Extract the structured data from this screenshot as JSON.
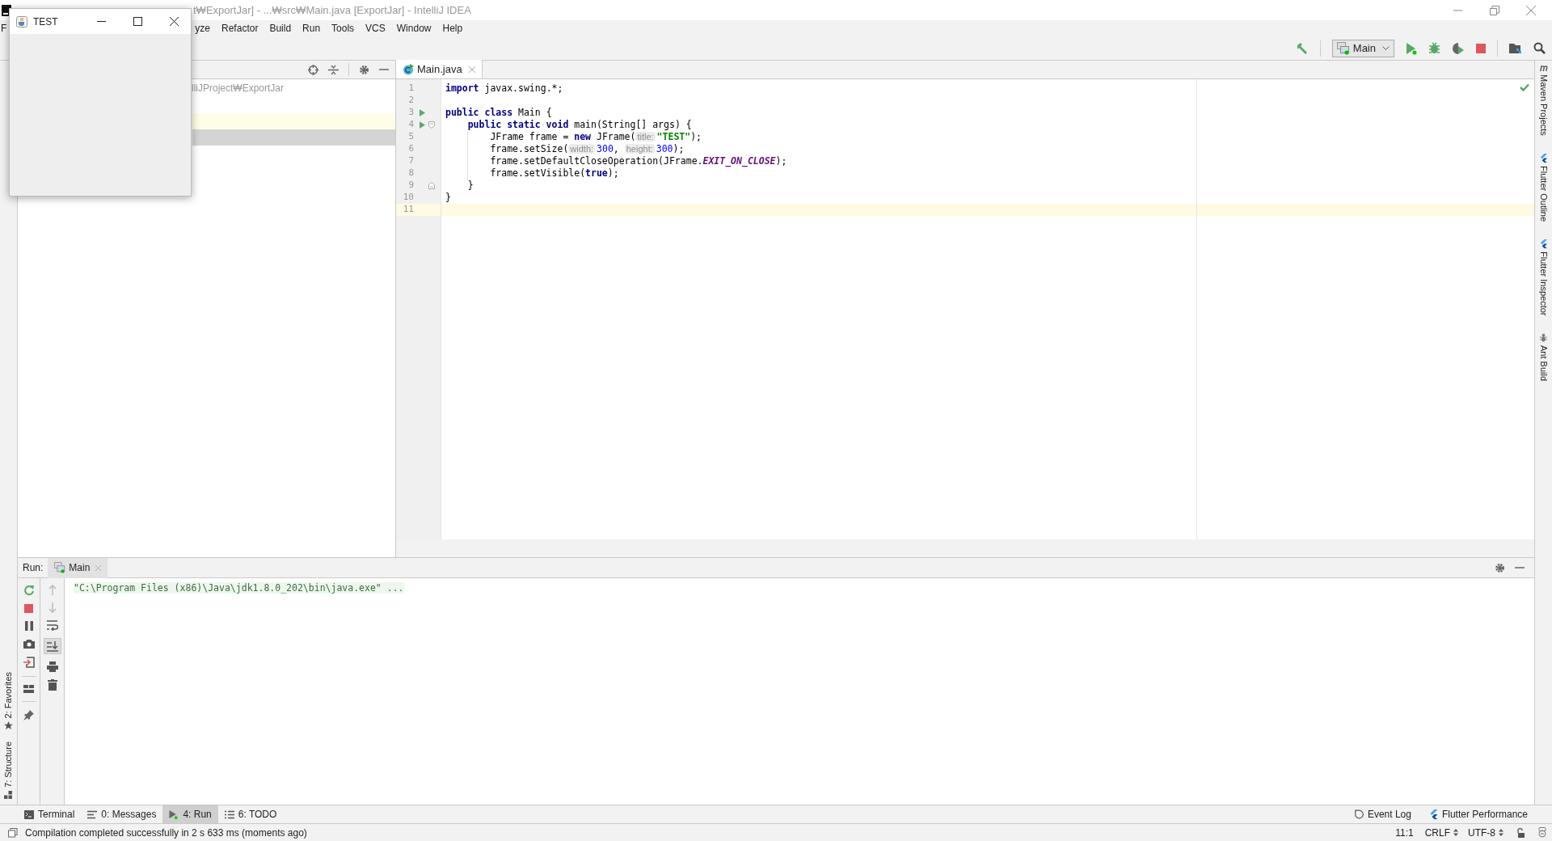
{
  "title_bar": {
    "text": "t₩ExportJar] - ...₩src₩Main.java [ExportJar] - IntelliJ IDEA"
  },
  "menu": [
    "F",
    "yze",
    "Refactor",
    "Build",
    "Run",
    "Tools",
    "VCS",
    "Window",
    "Help"
  ],
  "run_config": {
    "label": "Main"
  },
  "project_panel": {
    "path": "lliJProject₩ExportJar"
  },
  "editor_tab": {
    "label": "Main.java",
    "selected": true
  },
  "code_lines": [
    {
      "number": "1",
      "run_marker": false,
      "fold_start": false,
      "fold_end": false,
      "current": false,
      "tokens": [
        {
          "kind": "keyword",
          "text": "import"
        },
        {
          "kind": "plain",
          "text": " javax.swing.*;"
        }
      ]
    },
    {
      "number": "2",
      "run_marker": false,
      "fold_start": false,
      "fold_end": false,
      "current": false
    },
    {
      "number": "3",
      "run_marker": true,
      "fold_start": false,
      "fold_end": false,
      "current": false,
      "tokens": [
        {
          "kind": "keyword",
          "text": "public class"
        },
        {
          "kind": "plain",
          "text": " Main {"
        }
      ]
    },
    {
      "number": "4",
      "run_marker": true,
      "fold_start": true,
      "fold_end": false,
      "current": false,
      "tokens": [
        {
          "kind": "keyword",
          "text": "    public static void"
        },
        {
          "kind": "plain",
          "text": " main(String[] args) {"
        }
      ]
    },
    {
      "number": "5",
      "run_marker": false,
      "fold_start": false,
      "fold_end": false,
      "current": false,
      "tokens": [
        {
          "kind": "plain",
          "text": "        JFrame frame = "
        },
        {
          "kind": "keyword",
          "text": "new"
        },
        {
          "kind": "plain",
          "text": " JFrame("
        },
        {
          "kind": "hint",
          "text": "title:"
        },
        {
          "kind": "string",
          "text": "\"TEST\""
        },
        {
          "kind": "plain",
          "text": ");"
        }
      ]
    },
    {
      "number": "6",
      "run_marker": false,
      "fold_start": false,
      "fold_end": false,
      "current": false,
      "tokens": [
        {
          "kind": "plain",
          "text": "        frame.setSize("
        },
        {
          "kind": "hint",
          "text": "width:"
        },
        {
          "kind": "number",
          "text": "300"
        },
        {
          "kind": "plain",
          "text": ", "
        },
        {
          "kind": "hint",
          "text": "height:"
        },
        {
          "kind": "number",
          "text": "300"
        },
        {
          "kind": "plain",
          "text": ");"
        }
      ]
    },
    {
      "number": "7",
      "run_marker": false,
      "fold_start": false,
      "fold_end": false,
      "current": false,
      "tokens": [
        {
          "kind": "plain",
          "text": "        frame.setDefaultCloseOperation(JFrame."
        },
        {
          "kind": "constant",
          "text": "EXIT_ON_CLOSE"
        },
        {
          "kind": "plain",
          "text": ");"
        }
      ]
    },
    {
      "number": "8",
      "run_marker": false,
      "fold_start": false,
      "fold_end": false,
      "current": false,
      "tokens": [
        {
          "kind": "plain",
          "text": "        frame.setVisible("
        },
        {
          "kind": "keyword",
          "text": "true"
        },
        {
          "kind": "plain",
          "text": ");"
        }
      ]
    },
    {
      "number": "9",
      "run_marker": false,
      "fold_start": false,
      "fold_end": true,
      "current": false,
      "tokens": [
        {
          "kind": "plain",
          "text": "    }"
        }
      ]
    },
    {
      "number": "10",
      "run_marker": false,
      "fold_start": false,
      "fold_end": false,
      "current": false,
      "tokens": [
        {
          "kind": "plain",
          "text": "}"
        }
      ]
    },
    {
      "number": "11",
      "run_marker": false,
      "fold_start": false,
      "fold_end": false,
      "current": true
    }
  ],
  "run_panel": {
    "label": "Run:",
    "tab": {
      "label": "Main",
      "selected": true
    },
    "console": [
      "\"C:\\Program Files (x86)\\Java\\jdk1.8.0_202\\bin\\java.exe\" ..."
    ]
  },
  "left_strip": [
    {
      "label": "2: Favorites",
      "kind": "favorites"
    },
    {
      "label": "7: Structure",
      "kind": "structure"
    }
  ],
  "right_strip": [
    {
      "label": "Maven Projects",
      "kind": "maven"
    },
    {
      "label": "Flutter Outline",
      "kind": "flutter"
    },
    {
      "label": "Flutter Inspector",
      "kind": "flutter"
    },
    {
      "label": "Ant Build",
      "kind": "ant"
    }
  ],
  "bottom_tabs": [
    {
      "label": "Terminal",
      "kind": "terminal",
      "selected": false
    },
    {
      "label": "0: Messages",
      "kind": "messages",
      "selected": false
    },
    {
      "label": "4: Run",
      "kind": "run",
      "selected": true
    },
    {
      "label": "6: TODO",
      "kind": "todo",
      "selected": false
    }
  ],
  "bottom_right_tabs": [
    {
      "label": "Event Log",
      "kind": "event"
    },
    {
      "label": "Flutter Performance",
      "kind": "flutter"
    }
  ],
  "status_bar": {
    "message": "Compilation completed successfully in 2 s 633 ms (moments ago)",
    "position": "11:1",
    "line_separator": "CRLF",
    "encoding": "UTF-8"
  },
  "app_window": {
    "title": "TEST"
  }
}
